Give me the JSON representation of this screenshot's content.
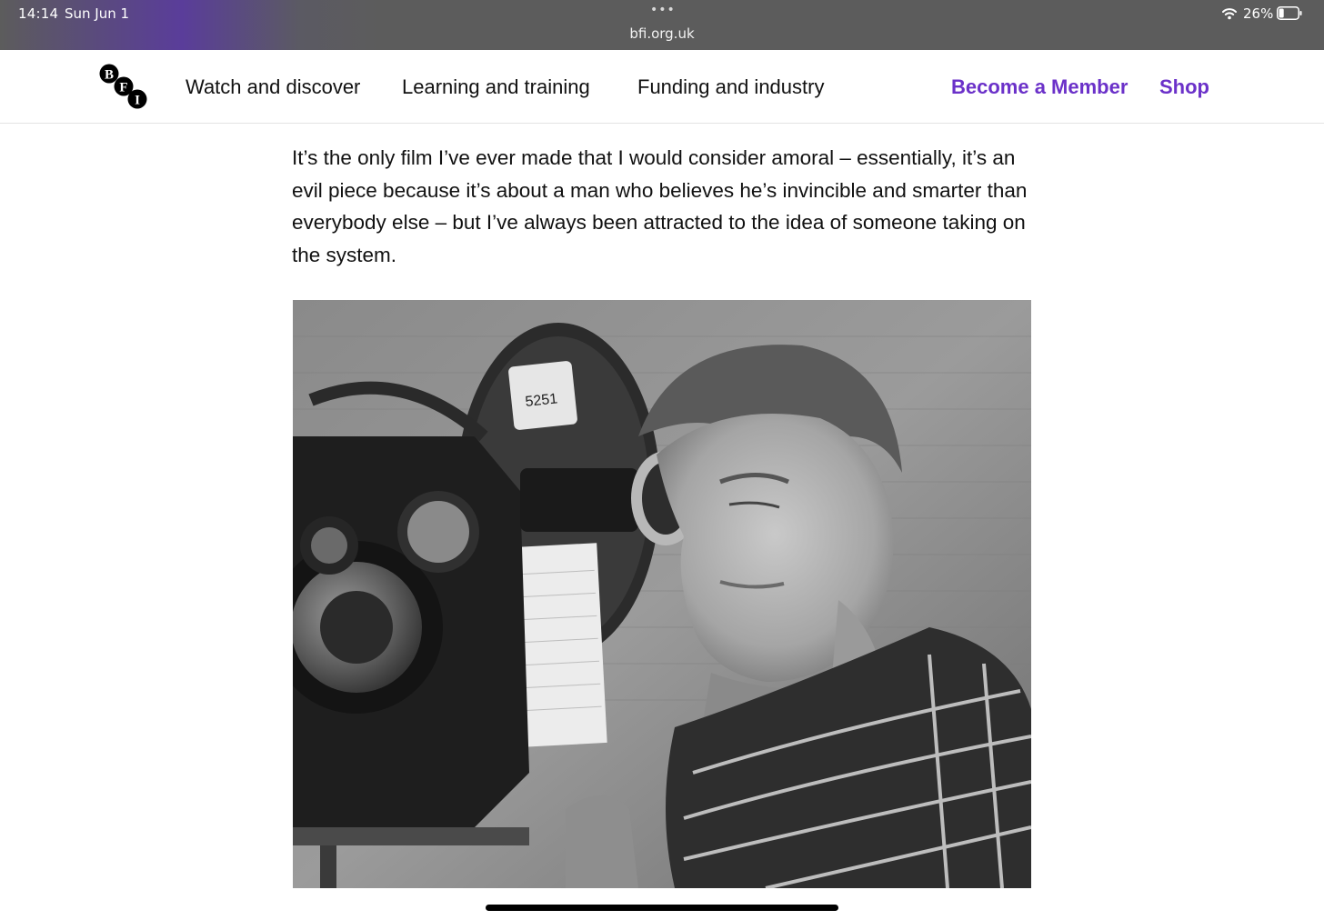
{
  "status_bar": {
    "time": "14:14",
    "date": "Sun Jun 1",
    "dots": "•••",
    "url": "bfi.org.uk",
    "battery": "26%",
    "battery_level": 0.26
  },
  "nav": {
    "logo_letters": [
      "B",
      "F",
      "I"
    ],
    "links": [
      "Watch and discover",
      "Learning and training",
      "Funding and industry"
    ],
    "member_label": "Become a Member",
    "shop_label": "Shop",
    "accent_color": "#6b31c9"
  },
  "article": {
    "paragraph": "It’s the only film I’ve ever made that I would consider amoral – essentially, it’s an evil piece because it’s about a man who believes he’s invincible and smarter than everybody else – but I’ve always been attracted to the idea of someone taking on the system."
  },
  "photo": {
    "slate_number": "5251"
  }
}
